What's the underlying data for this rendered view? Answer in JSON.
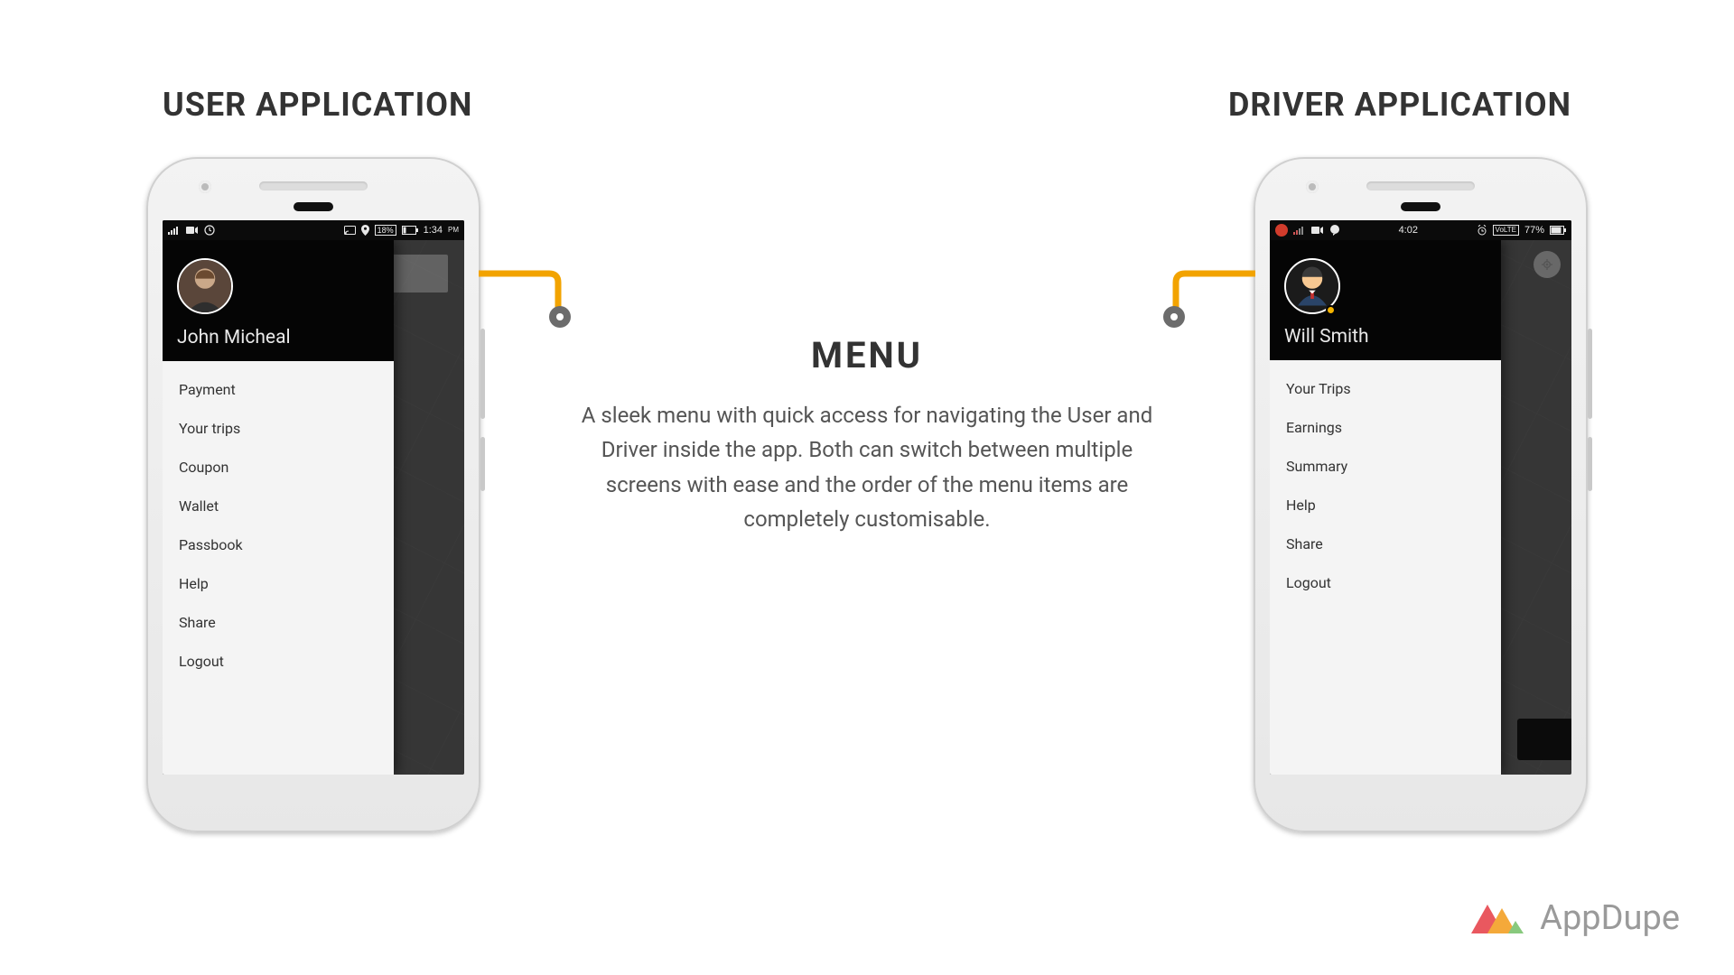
{
  "headings": {
    "left": "USER APPLICATION",
    "right": "DRIVER APPLICATION"
  },
  "center": {
    "title": "MENU",
    "description": "A sleek menu with quick access for navigating the User and Driver inside the app. Both can switch between multiple screens with ease and the order of the menu items are completely customisable."
  },
  "user_phone": {
    "status": {
      "time": "1:34",
      "ampm": "PM",
      "battery_percent": "18%"
    },
    "profile_name": "John Micheal",
    "menu_items": [
      "Payment",
      "Your trips",
      "Coupon",
      "Wallet",
      "Passbook",
      "Help",
      "Share",
      "Logout"
    ]
  },
  "driver_phone": {
    "status": {
      "time": "4:02",
      "battery_percent": "77%",
      "lte_label": "VoLTE"
    },
    "profile_name": "Will Smith",
    "menu_items": [
      "Your Trips",
      "Earnings",
      "Summary",
      "Help",
      "Share",
      "Logout"
    ]
  },
  "brand": {
    "name": "AppDupe"
  }
}
